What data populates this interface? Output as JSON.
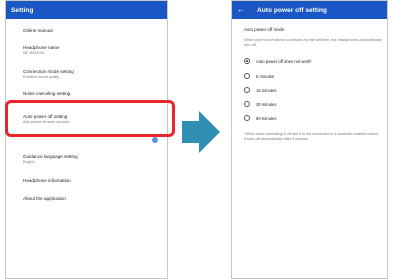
{
  "left_screen": {
    "title": "Setting",
    "items": [
      {
        "title": "Online manual",
        "subtitle": ""
      },
      {
        "title": "Headphone name",
        "subtitle": "WF-H0ATOM"
      },
      {
        "title": "Connection mode setting",
        "subtitle": "Prioritize sound quality"
      },
      {
        "title": "Noise canceling setting",
        "subtitle": ""
      },
      {
        "title": "Auto power off setting",
        "subtitle": "Auto power off does not work"
      },
      {
        "title": "Guidance language setting",
        "subtitle": "English"
      },
      {
        "title": "Headphone information",
        "subtitle": ""
      },
      {
        "title": "About the application",
        "subtitle": ""
      }
    ]
  },
  "right_screen": {
    "back_glyph": "←",
    "title": "Auto power off setting",
    "section_label": "Auto power off mode",
    "description": "When a period of silence continues for the set time, the headphones automatically turn off.",
    "options": [
      {
        "label": "Auto power off does not work*",
        "checked": true
      },
      {
        "label": "5 minutes",
        "checked": false
      },
      {
        "label": "15 minutes",
        "checked": false
      },
      {
        "label": "30 minutes",
        "checked": false
      },
      {
        "label": "60 minutes",
        "checked": false
      }
    ],
    "note": "*When noise cancelling is off and it is not connected to a bluetooth enabled device, it turns off automatically after 5 minutes."
  },
  "colors": {
    "appbar": "#1a56c4",
    "highlight": "#e8262c",
    "arrow": "#2f8fb5"
  }
}
